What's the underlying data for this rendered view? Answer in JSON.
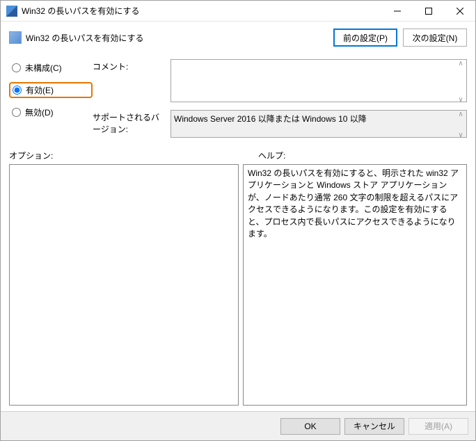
{
  "title": "Win32 の長いパスを有効にする",
  "header": {
    "title": "Win32 の長いパスを有効にする",
    "prev_label": "前の設定(P)",
    "next_label": "次の設定(N)"
  },
  "radios": {
    "not_configured": "未構成(C)",
    "enabled": "有効(E)",
    "disabled": "無効(D)",
    "selected": "enabled"
  },
  "fields": {
    "comment_label": "コメント:",
    "comment_value": "",
    "supported_label": "サポートされるバージョン:",
    "supported_value": "Windows Server 2016 以降または Windows 10 以降"
  },
  "options_label": "オプション:",
  "help_label": "ヘルプ:",
  "options_text": "",
  "help_text": "Win32 の長いパスを有効にすると、明示された win32 アプリケーションと Windows ストア アプリケーションが、ノードあたり通常 260 文字の制限を超えるパスにアクセスできるようになります。この設定を有効にすると、プロセス内で長いパスにアクセスできるようになります。",
  "footer": {
    "ok": "OK",
    "cancel": "キャンセル",
    "apply": "適用(A)"
  }
}
